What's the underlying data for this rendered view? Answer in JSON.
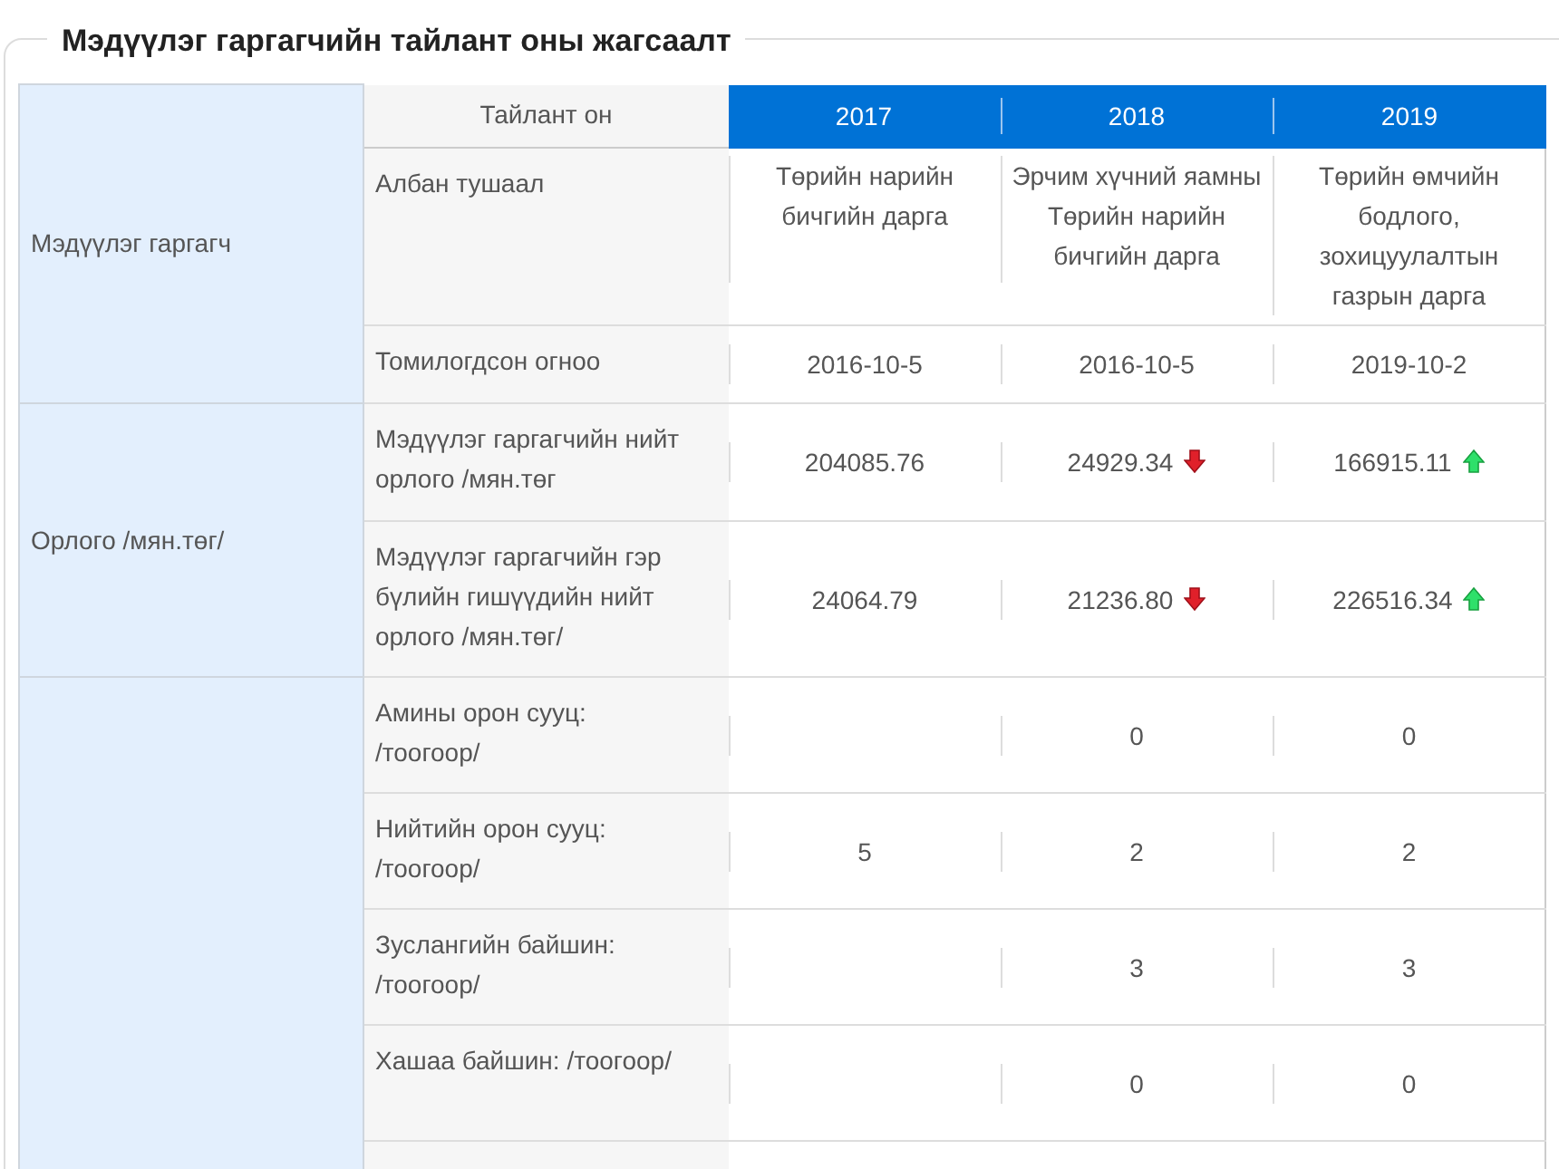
{
  "title": "Мэдүүлэг гаргагчийн тайлант оны жагсаалт",
  "header": {
    "label": "Тайлант он",
    "years": [
      "2017",
      "2018",
      "2019"
    ]
  },
  "groups": [
    {
      "label": "Мэдүүлэг гаргагч",
      "rows": [
        {
          "label": "Албан тушаал",
          "kind": "text",
          "values": [
            {
              "text": "Төрийн нарийн бичгийн дарга",
              "kind": "plain"
            },
            {
              "text": "Эрчим хүчний яамны Төрийн нарийн бичгийн дарга",
              "kind": "plain"
            },
            {
              "text": "Төрийн өмчийн бодлого, зохицуулалтын газрын дарга",
              "kind": "plain"
            }
          ]
        },
        {
          "label": "Томилогдсон огноо",
          "kind": "value",
          "values": [
            {
              "text": "2016-10-5",
              "kind": "plain"
            },
            {
              "text": "2016-10-5",
              "kind": "plain"
            },
            {
              "text": "2019-10-2",
              "kind": "plain"
            }
          ]
        }
      ]
    },
    {
      "label": "Орлого /мян.төг/",
      "rows": [
        {
          "label": "Мэдүүлэг гаргагчийн нийт орлого /мян.төг",
          "kind": "value",
          "values": [
            {
              "text": "204085.76",
              "kind": "plain"
            },
            {
              "text": "24929.34",
              "kind": "down"
            },
            {
              "text": "166915.11",
              "kind": "up"
            }
          ]
        },
        {
          "label": "Мэдүүлэг гаргагчийн гэр бүлийн гишүүдийн нийт орлого /мян.төг/",
          "kind": "value",
          "values": [
            {
              "text": "24064.79",
              "kind": "plain"
            },
            {
              "text": "21236.80",
              "kind": "down"
            },
            {
              "text": "226516.34",
              "kind": "up"
            }
          ]
        }
      ]
    },
    {
      "rows": [
        {
          "label": "Амины орон сууц: /тоогоор/",
          "kind": "value",
          "values": [
            {
              "kind": "plain"
            },
            {
              "text": "0",
              "kind": "plain"
            },
            {
              "text": "0",
              "kind": "plain"
            }
          ]
        },
        {
          "label": "Нийтийн орон сууц: /тоогоор/",
          "kind": "value",
          "values": [
            {
              "text": "5",
              "kind": "plain"
            },
            {
              "text": "2",
              "kind": "plain"
            },
            {
              "text": "2",
              "kind": "plain"
            }
          ]
        },
        {
          "label": "Зуслангийн байшин: /тоогоор/",
          "kind": "value",
          "values": [
            {
              "kind": "plain"
            },
            {
              "text": "3",
              "kind": "plain"
            },
            {
              "text": "3",
              "kind": "plain"
            }
          ]
        },
        {
          "label": "Хашаа байшин: /тоогоор/",
          "kind": "value",
          "values": [
            {
              "kind": "plain"
            },
            {
              "text": "0",
              "kind": "plain"
            },
            {
              "text": "0",
              "kind": "plain"
            }
          ]
        }
      ]
    }
  ]
}
